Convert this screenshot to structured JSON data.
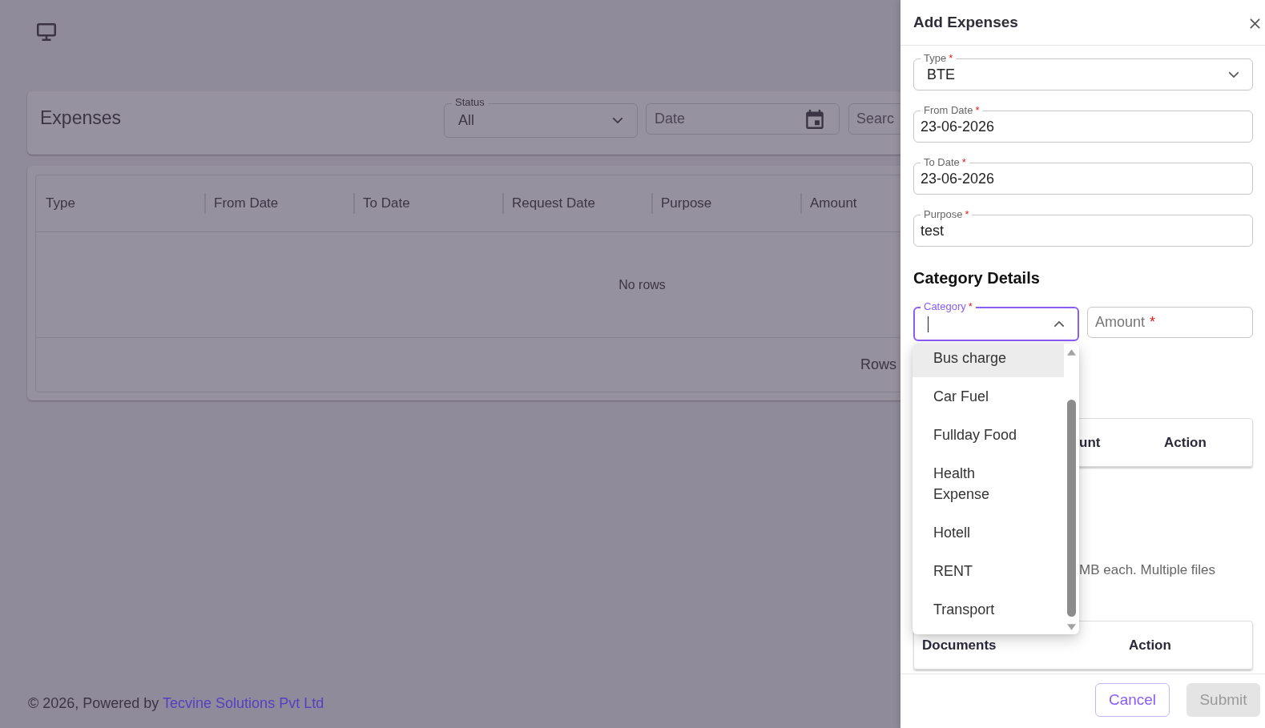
{
  "page": {
    "title": "Expenses",
    "filters": {
      "status": {
        "label": "Status",
        "value": "All"
      },
      "date": {
        "placeholder": "Date"
      },
      "search": {
        "placeholder": "Searc"
      }
    },
    "table": {
      "columns": [
        "Type",
        "From Date",
        "To Date",
        "Request Date",
        "Purpose",
        "Amount"
      ],
      "empty_message": "No rows",
      "footer_text": "Rows"
    },
    "footer": {
      "text": "© 2026, Powered by",
      "link": "Tecvine Solutions Pvt Ltd"
    }
  },
  "drawer": {
    "title": "Add Expenses",
    "fields": [
      {
        "kind": "select",
        "label": "Type",
        "asterisk": "*",
        "value": "BTE"
      },
      {
        "kind": "text",
        "label": "From Date",
        "asterisk": "*",
        "value": "23-06-2026"
      },
      {
        "kind": "text",
        "label": "To Date",
        "asterisk": "*",
        "value": "23-06-2026"
      },
      {
        "kind": "text",
        "label": "Purpose",
        "asterisk": "*",
        "value": "test"
      }
    ],
    "section_title": "Category Details",
    "category": {
      "label": "Category",
      "asterisk": "*",
      "focused": true,
      "expanded": true,
      "options": [
        {
          "label": "Bus charge",
          "highlighted": true
        },
        {
          "label": "Car Fuel",
          "highlighted": false
        },
        {
          "label": "Fullday Food",
          "highlighted": false
        },
        {
          "label": "Health Expense",
          "highlighted": false
        },
        {
          "label": "Hotell",
          "highlighted": false
        },
        {
          "label": "RENT",
          "highlighted": false
        },
        {
          "label": "Transport",
          "highlighted": false
        }
      ]
    },
    "amount": {
      "placeholder": "Amount",
      "asterisk": "*"
    },
    "category_table": {
      "columns": [
        "unt",
        "Action"
      ]
    },
    "upload_hint": "MB each. Multiple files",
    "documents_table": {
      "columns": [
        "Documents",
        "Action"
      ]
    },
    "buttons": [
      {
        "kind": "outlined",
        "label": "Cancel",
        "disabled": false
      },
      {
        "kind": "contained",
        "label": "Submit",
        "disabled": true
      }
    ]
  }
}
